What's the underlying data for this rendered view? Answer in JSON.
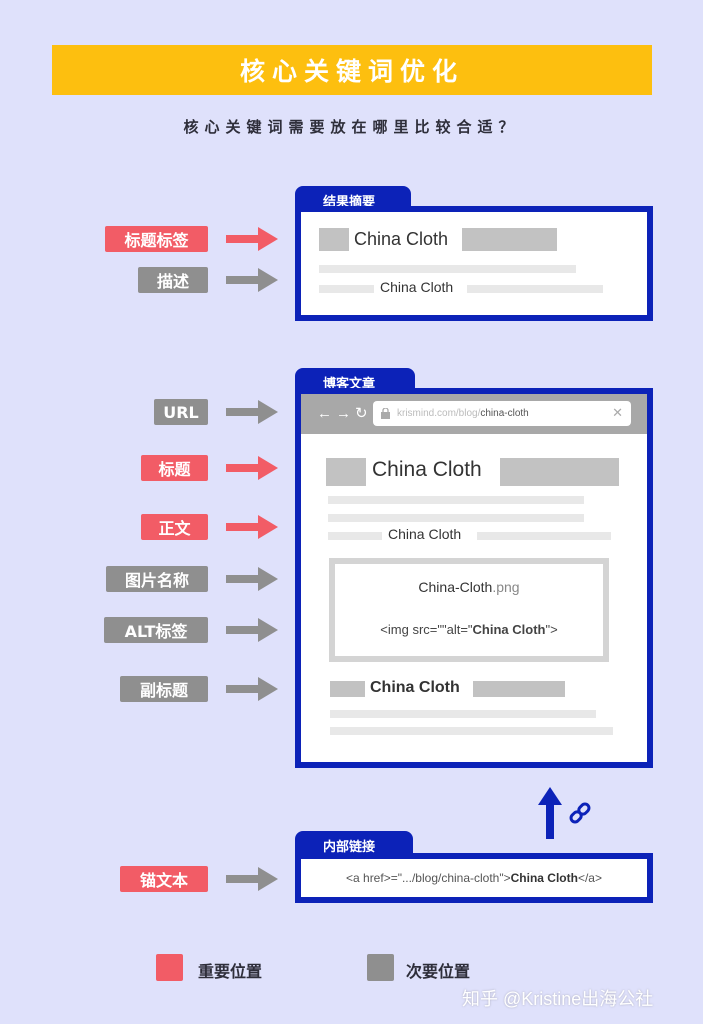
{
  "header": {
    "title": "核心关键词优化",
    "subtitle": "核心关键词需要放在哪里比较合适？"
  },
  "colors": {
    "background": "#dfe1fb",
    "banner": "#fdbf0f",
    "important": "#f25c66",
    "secondary": "#8f8f8f",
    "panel_border": "#0c22b8"
  },
  "serp_panel": {
    "tab_label": "结果摘要",
    "title_keyword": "China Cloth",
    "desc_keyword": "China Cloth",
    "labels": [
      {
        "text": "标题标签",
        "priority": "important"
      },
      {
        "text": "描述",
        "priority": "secondary"
      }
    ]
  },
  "blog_panel": {
    "tab_label": "博客文章",
    "url_prefix": "krismind.com/blog/",
    "url_path": "china-cloth",
    "nav_icons": [
      "back-icon",
      "forward-icon",
      "refresh-icon"
    ],
    "title_keyword": "China Cloth",
    "body_keyword": "China Cloth",
    "image_name_bold": "China-Cloth",
    "image_name_ext": ".png",
    "alt_prefix": "<img src=\"\"alt=\"",
    "alt_keyword": "China Cloth",
    "alt_suffix": "\">",
    "subtitle_keyword": "China Cloth",
    "labels": [
      {
        "text": "URL",
        "priority": "secondary"
      },
      {
        "text": "标题",
        "priority": "important"
      },
      {
        "text": "正文",
        "priority": "important"
      },
      {
        "text": "图片名称",
        "priority": "secondary"
      },
      {
        "text": "ALT标签",
        "priority": "secondary"
      },
      {
        "text": "副标题",
        "priority": "secondary"
      }
    ]
  },
  "link_panel": {
    "tab_label": "内部链接",
    "code_prefix": "<a href>=\".../blog/china-cloth\">",
    "code_keyword": "China Cloth",
    "code_suffix": "</a>",
    "labels": [
      {
        "text": "锚文本",
        "priority": "important"
      }
    ]
  },
  "legend": [
    {
      "text": "重要位置",
      "color": "#f25c66"
    },
    {
      "text": "次要位置",
      "color": "#8f8f8f"
    }
  ],
  "watermark": "知乎 @Kristine出海公社"
}
